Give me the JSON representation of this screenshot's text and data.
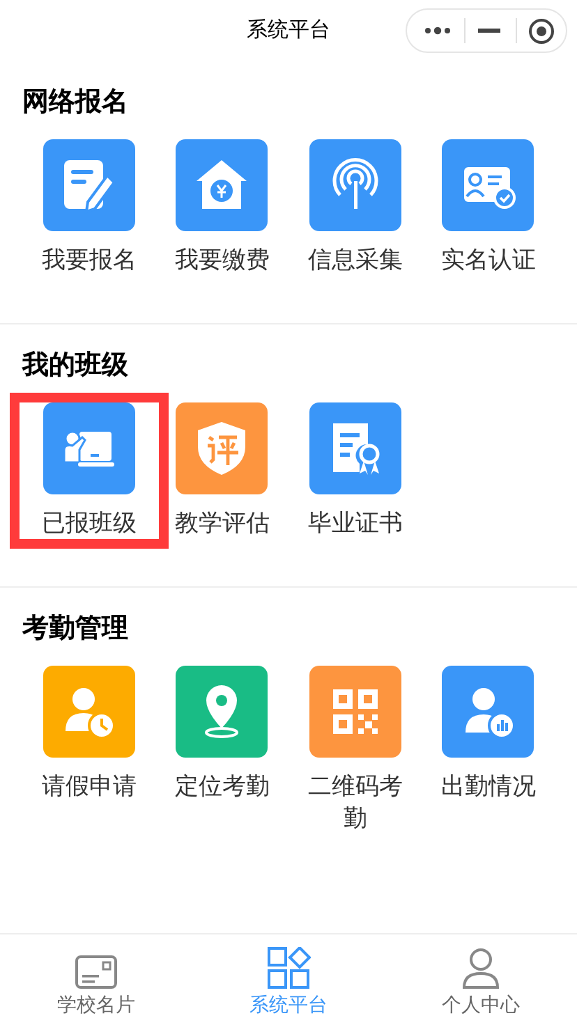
{
  "header": {
    "title": "系统平台"
  },
  "sections": [
    {
      "title": "网络报名",
      "items": [
        {
          "label": "我要报名",
          "color": "#3a96f8",
          "highlighted": false
        },
        {
          "label": "我要缴费",
          "color": "#3a96f8",
          "highlighted": false
        },
        {
          "label": "信息采集",
          "color": "#3a96f8",
          "highlighted": false
        },
        {
          "label": "实名认证",
          "color": "#3a96f8",
          "highlighted": false
        }
      ]
    },
    {
      "title": "我的班级",
      "items": [
        {
          "label": "已报班级",
          "color": "#3a96f8",
          "highlighted": true
        },
        {
          "label": "教学评估",
          "color": "#fd953f",
          "highlighted": false
        },
        {
          "label": "毕业证书",
          "color": "#3a96f8",
          "highlighted": false
        }
      ]
    },
    {
      "title": "考勤管理",
      "items": [
        {
          "label": "请假申请",
          "color": "#fdab00",
          "highlighted": false
        },
        {
          "label": "定位考勤",
          "color": "#19bc85",
          "highlighted": false
        },
        {
          "label": "二维码考勤",
          "color": "#fd953f",
          "highlighted": false
        },
        {
          "label": "出勤情况",
          "color": "#3a96f8",
          "highlighted": false
        }
      ]
    }
  ],
  "tab_bar": [
    {
      "label": "学校名片",
      "selected": false
    },
    {
      "label": "系统平台",
      "selected": true
    },
    {
      "label": "个人中心",
      "selected": false
    }
  ]
}
